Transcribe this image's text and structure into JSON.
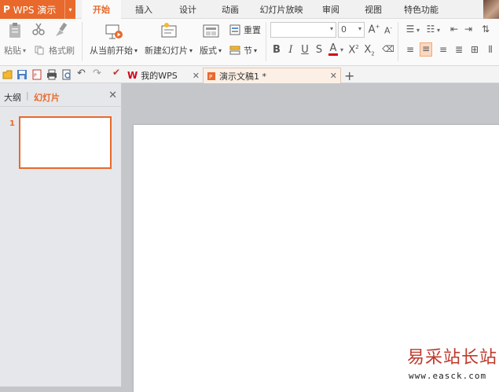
{
  "app": {
    "name": "WPS 演示",
    "caret": "▾"
  },
  "ribbon_tabs": [
    "开始",
    "插入",
    "设计",
    "动画",
    "幻灯片放映",
    "审阅",
    "视图",
    "特色功能"
  ],
  "ribbon": {
    "paste": "粘贴",
    "format_painter": "格式刷",
    "start_from_current": "从当前开始",
    "new_slide": "新建幻灯片",
    "layout": "版式",
    "reset": "重置",
    "section": "节",
    "font_size": "0"
  },
  "doc_tabs": [
    {
      "label": "我的WPS"
    },
    {
      "label": "演示文稿1 *"
    }
  ],
  "left_pane": {
    "tab_outline": "大纲",
    "tab_slides": "幻灯片",
    "slide_number": "1"
  },
  "watermark": {
    "title": "易采站长站",
    "url": "www.easck.com"
  },
  "colors": {
    "accent": "#e8692b",
    "font_color_bar": "#d0021b"
  }
}
